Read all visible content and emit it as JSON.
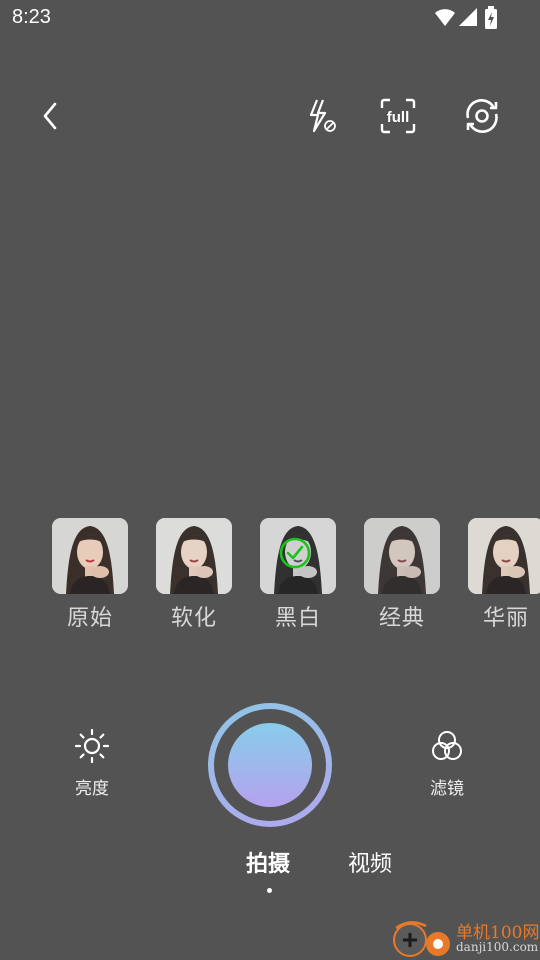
{
  "status_bar": {
    "time": "8:23",
    "icons": [
      "wifi-icon",
      "cellular-signal-icon",
      "battery-charging-icon"
    ]
  },
  "top_bar": {
    "back_icon": "chevron-left-icon",
    "flash_icon": "flash-off-icon",
    "aspect_label": "full",
    "switch_camera_icon": "camera-switch-icon"
  },
  "filters": {
    "items": [
      {
        "label": "原始"
      },
      {
        "label": "软化"
      },
      {
        "label": "黑白",
        "selected": true
      },
      {
        "label": "经典"
      },
      {
        "label": "华丽"
      }
    ],
    "selected_color": "#19c419"
  },
  "controls": {
    "brightness_label": "亮度",
    "filter_label": "滤镜"
  },
  "modes": {
    "photo_label": "拍摄",
    "video_label": "视频",
    "active": "拍摄"
  },
  "shutter": {
    "gradient_start": "#87cdea",
    "gradient_end": "#b5a2ee"
  },
  "watermark": {
    "name": "单机100网",
    "url": "danji100.com"
  },
  "colors": {
    "background": "#535353",
    "brand_orange": "#e8792a"
  }
}
